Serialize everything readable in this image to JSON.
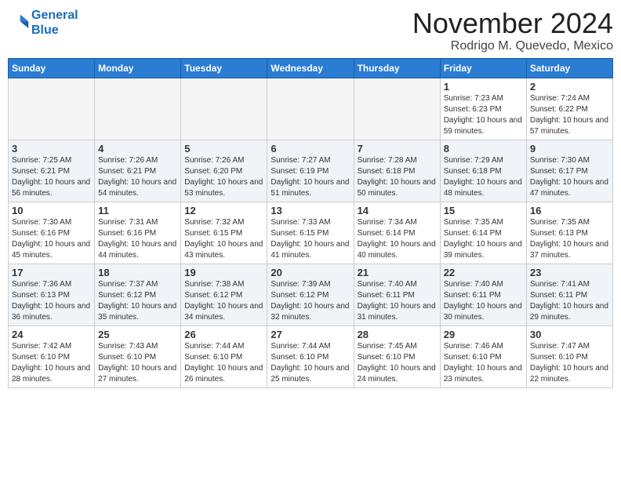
{
  "header": {
    "logo_line1": "General",
    "logo_line2": "Blue",
    "month": "November 2024",
    "location": "Rodrigo M. Quevedo, Mexico"
  },
  "weekdays": [
    "Sunday",
    "Monday",
    "Tuesday",
    "Wednesday",
    "Thursday",
    "Friday",
    "Saturday"
  ],
  "weeks": [
    [
      {
        "day": "",
        "empty": true
      },
      {
        "day": "",
        "empty": true
      },
      {
        "day": "",
        "empty": true
      },
      {
        "day": "",
        "empty": true
      },
      {
        "day": "",
        "empty": true
      },
      {
        "day": "1",
        "sunrise": "7:23 AM",
        "sunset": "6:23 PM",
        "daylight": "10 hours and 59 minutes."
      },
      {
        "day": "2",
        "sunrise": "7:24 AM",
        "sunset": "6:22 PM",
        "daylight": "10 hours and 57 minutes."
      }
    ],
    [
      {
        "day": "3",
        "sunrise": "7:25 AM",
        "sunset": "6:21 PM",
        "daylight": "10 hours and 56 minutes."
      },
      {
        "day": "4",
        "sunrise": "7:26 AM",
        "sunset": "6:21 PM",
        "daylight": "10 hours and 54 minutes."
      },
      {
        "day": "5",
        "sunrise": "7:26 AM",
        "sunset": "6:20 PM",
        "daylight": "10 hours and 53 minutes."
      },
      {
        "day": "6",
        "sunrise": "7:27 AM",
        "sunset": "6:19 PM",
        "daylight": "10 hours and 51 minutes."
      },
      {
        "day": "7",
        "sunrise": "7:28 AM",
        "sunset": "6:18 PM",
        "daylight": "10 hours and 50 minutes."
      },
      {
        "day": "8",
        "sunrise": "7:29 AM",
        "sunset": "6:18 PM",
        "daylight": "10 hours and 48 minutes."
      },
      {
        "day": "9",
        "sunrise": "7:30 AM",
        "sunset": "6:17 PM",
        "daylight": "10 hours and 47 minutes."
      }
    ],
    [
      {
        "day": "10",
        "sunrise": "7:30 AM",
        "sunset": "6:16 PM",
        "daylight": "10 hours and 45 minutes."
      },
      {
        "day": "11",
        "sunrise": "7:31 AM",
        "sunset": "6:16 PM",
        "daylight": "10 hours and 44 minutes."
      },
      {
        "day": "12",
        "sunrise": "7:32 AM",
        "sunset": "6:15 PM",
        "daylight": "10 hours and 43 minutes."
      },
      {
        "day": "13",
        "sunrise": "7:33 AM",
        "sunset": "6:15 PM",
        "daylight": "10 hours and 41 minutes."
      },
      {
        "day": "14",
        "sunrise": "7:34 AM",
        "sunset": "6:14 PM",
        "daylight": "10 hours and 40 minutes."
      },
      {
        "day": "15",
        "sunrise": "7:35 AM",
        "sunset": "6:14 PM",
        "daylight": "10 hours and 39 minutes."
      },
      {
        "day": "16",
        "sunrise": "7:35 AM",
        "sunset": "6:13 PM",
        "daylight": "10 hours and 37 minutes."
      }
    ],
    [
      {
        "day": "17",
        "sunrise": "7:36 AM",
        "sunset": "6:13 PM",
        "daylight": "10 hours and 36 minutes."
      },
      {
        "day": "18",
        "sunrise": "7:37 AM",
        "sunset": "6:12 PM",
        "daylight": "10 hours and 35 minutes."
      },
      {
        "day": "19",
        "sunrise": "7:38 AM",
        "sunset": "6:12 PM",
        "daylight": "10 hours and 34 minutes."
      },
      {
        "day": "20",
        "sunrise": "7:39 AM",
        "sunset": "6:12 PM",
        "daylight": "10 hours and 32 minutes."
      },
      {
        "day": "21",
        "sunrise": "7:40 AM",
        "sunset": "6:11 PM",
        "daylight": "10 hours and 31 minutes."
      },
      {
        "day": "22",
        "sunrise": "7:40 AM",
        "sunset": "6:11 PM",
        "daylight": "10 hours and 30 minutes."
      },
      {
        "day": "23",
        "sunrise": "7:41 AM",
        "sunset": "6:11 PM",
        "daylight": "10 hours and 29 minutes."
      }
    ],
    [
      {
        "day": "24",
        "sunrise": "7:42 AM",
        "sunset": "6:10 PM",
        "daylight": "10 hours and 28 minutes."
      },
      {
        "day": "25",
        "sunrise": "7:43 AM",
        "sunset": "6:10 PM",
        "daylight": "10 hours and 27 minutes."
      },
      {
        "day": "26",
        "sunrise": "7:44 AM",
        "sunset": "6:10 PM",
        "daylight": "10 hours and 26 minutes."
      },
      {
        "day": "27",
        "sunrise": "7:44 AM",
        "sunset": "6:10 PM",
        "daylight": "10 hours and 25 minutes."
      },
      {
        "day": "28",
        "sunrise": "7:45 AM",
        "sunset": "6:10 PM",
        "daylight": "10 hours and 24 minutes."
      },
      {
        "day": "29",
        "sunrise": "7:46 AM",
        "sunset": "6:10 PM",
        "daylight": "10 hours and 23 minutes."
      },
      {
        "day": "30",
        "sunrise": "7:47 AM",
        "sunset": "6:10 PM",
        "daylight": "10 hours and 22 minutes."
      }
    ]
  ],
  "labels": {
    "sunrise": "Sunrise:",
    "sunset": "Sunset:",
    "daylight": "Daylight:"
  }
}
